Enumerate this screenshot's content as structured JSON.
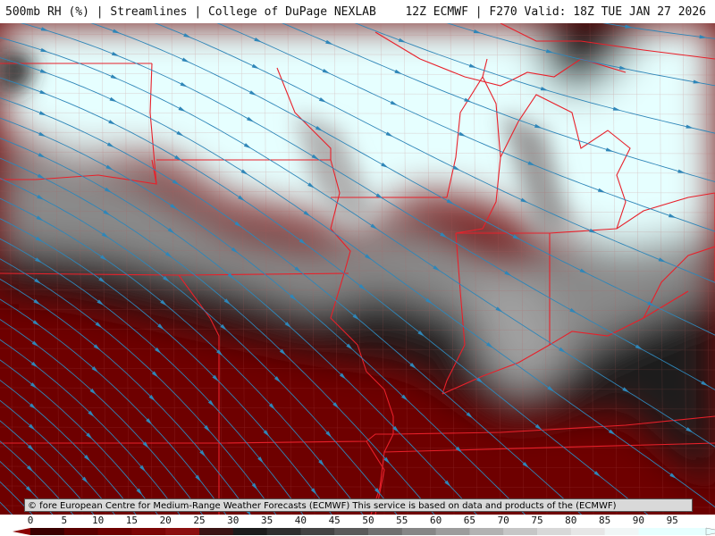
{
  "header": {
    "left_title": "500mb RH (%) | Streamlines | College of DuPage NEXLAB",
    "right_title": "12Z ECMWF | F270 Valid: 18Z TUE JAN 27 2026"
  },
  "map": {
    "field": "500mb Relative Humidity",
    "overlay": "Streamlines",
    "colors": {
      "streamline": "#2f86b8",
      "state_border": "#e8202a",
      "county_border": "#b85a5a",
      "dry": "#6e0000",
      "moist": "#e6ffff"
    }
  },
  "credit": "© fore European Centre for Medium-Range Weather Forecasts (ECMWF)  This service is based on data and products of the (ECMWF)",
  "colorbar": {
    "ticks": [
      "0",
      "5",
      "10",
      "15",
      "20",
      "25",
      "30",
      "35",
      "40",
      "45",
      "50",
      "55",
      "60",
      "65",
      "70",
      "75",
      "80",
      "85",
      "90",
      "95"
    ],
    "colors": [
      "#3a0000",
      "#5a0000",
      "#6e0000",
      "#7c0505",
      "#8a0f0f",
      "#3a1414",
      "#1c1c1c",
      "#2e2e2e",
      "#444444",
      "#5a5a5a",
      "#707070",
      "#868686",
      "#9c9c9c",
      "#b2b2b2",
      "#c6c6c6",
      "#d8d8d8",
      "#e6e6e6",
      "#f0f6f6",
      "#e6ffff",
      "#e6ffff"
    ]
  }
}
